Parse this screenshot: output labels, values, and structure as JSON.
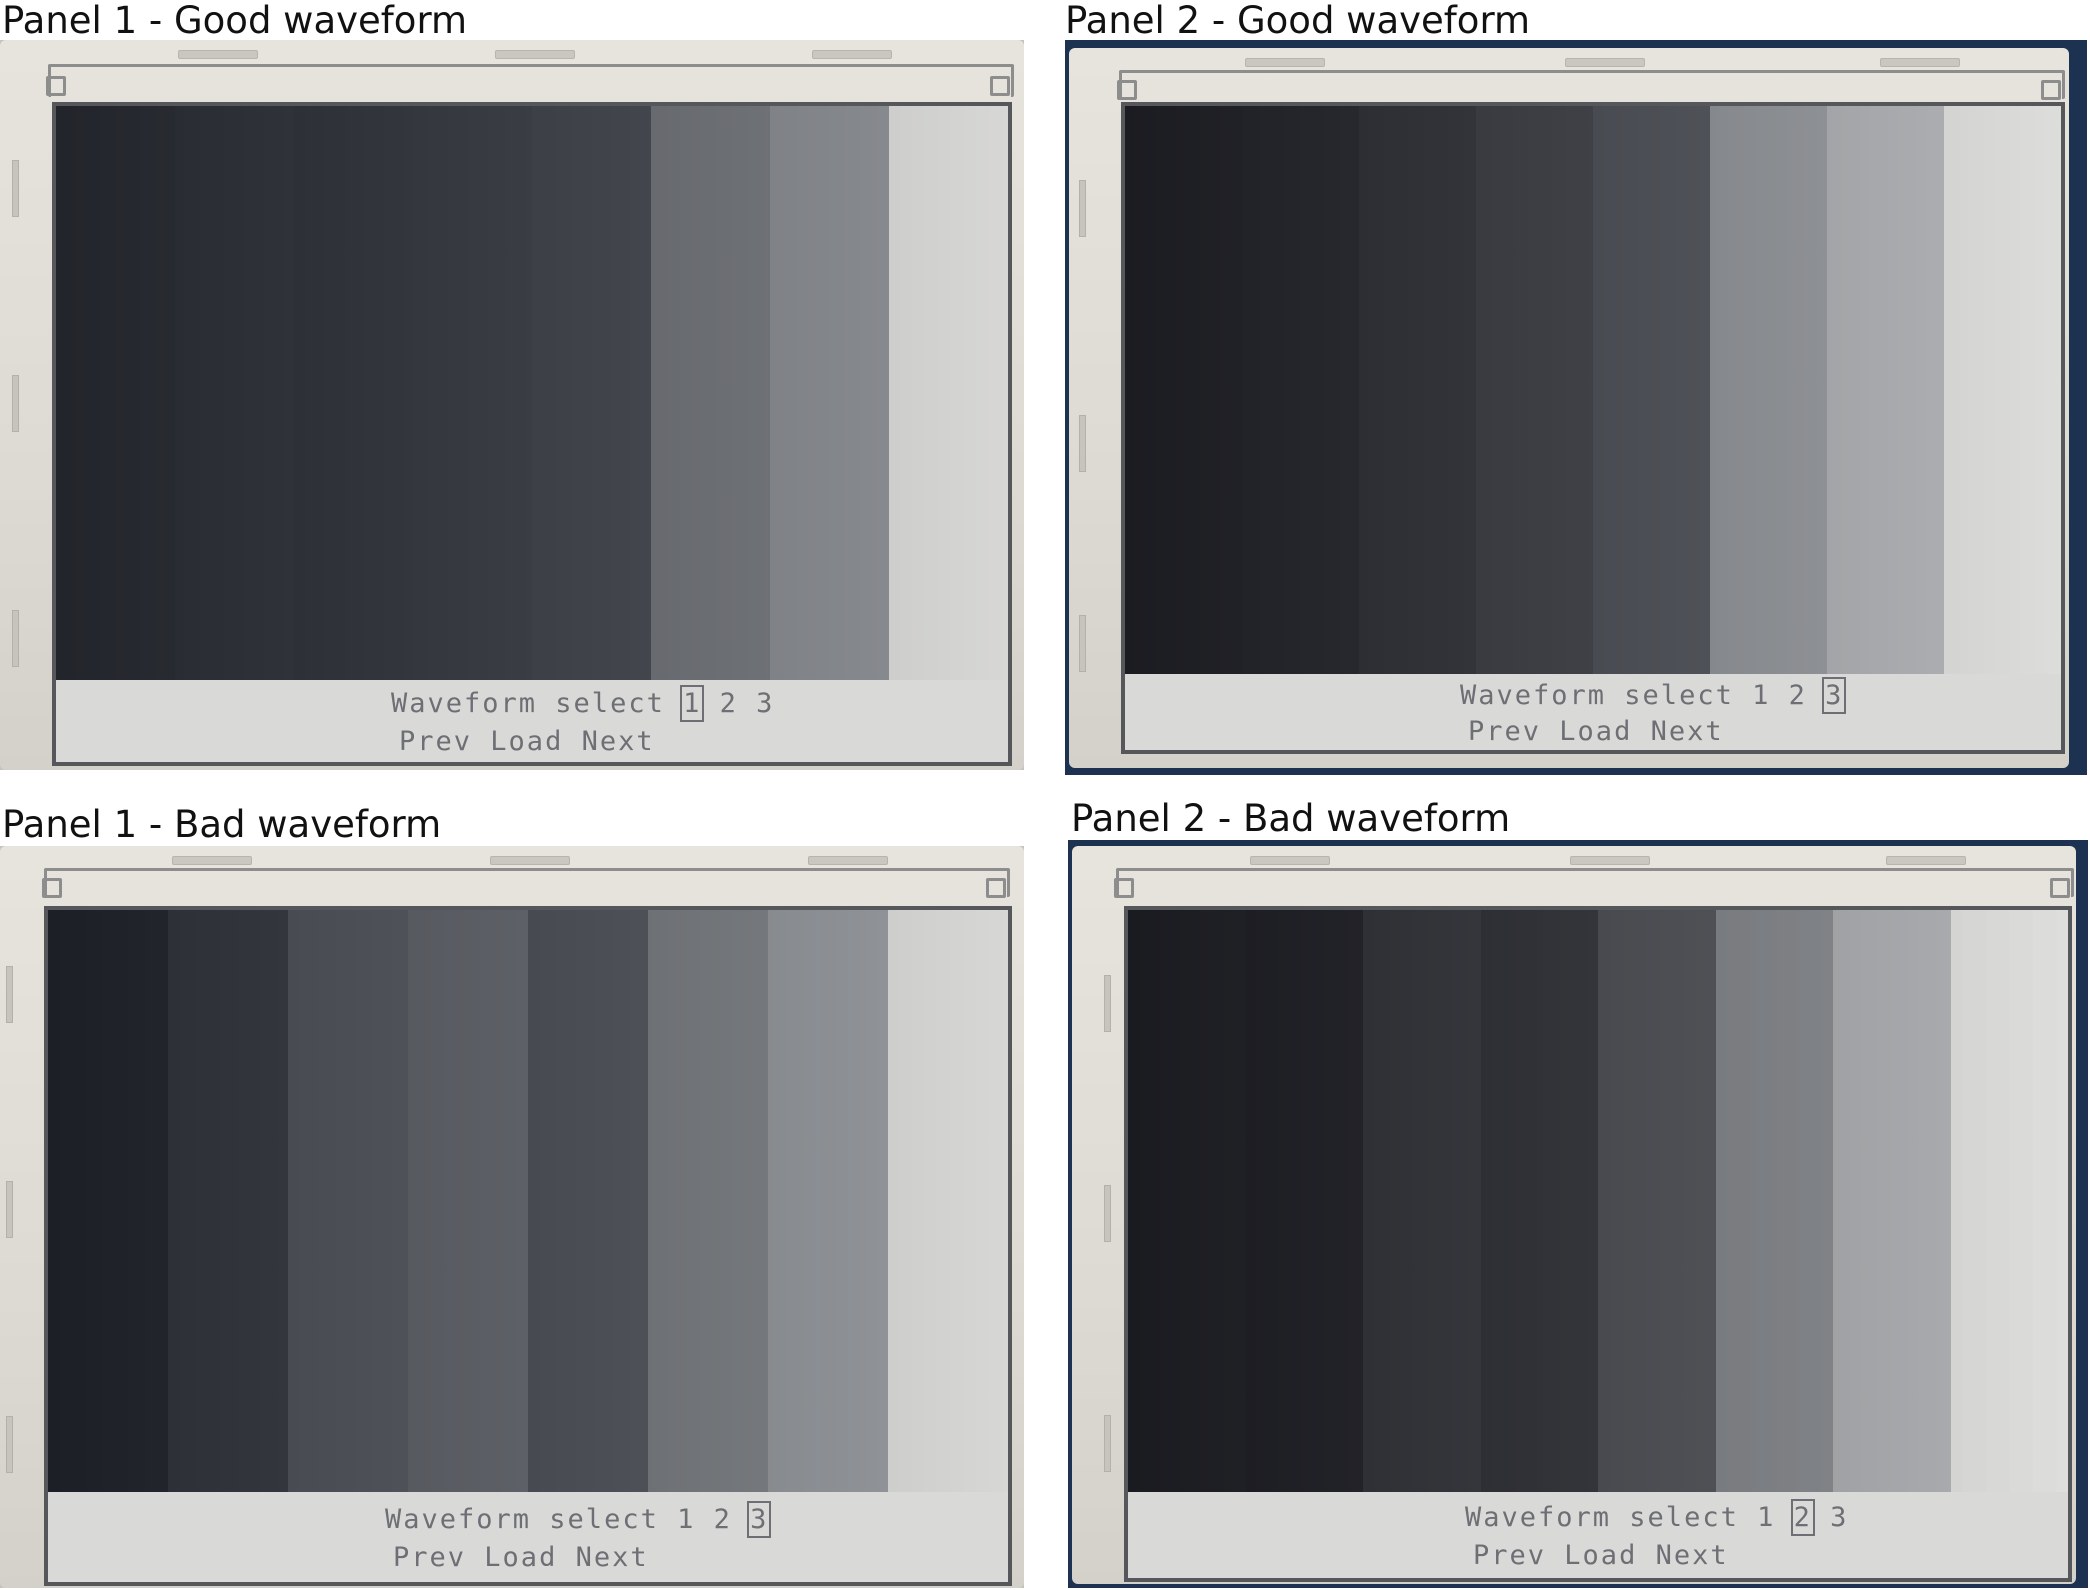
{
  "panels": [
    {
      "caption": "Panel 1 - Good waveform",
      "bars": [
        "#24262d",
        "#2b2e35",
        "#2f3239",
        "#363940",
        "#3f4249",
        "#6b6e73",
        "#84878c",
        "#d6d7d5"
      ],
      "waveform_label": "Waveform select",
      "options": [
        "1",
        "2",
        "3"
      ],
      "selected_option": "1",
      "nav": [
        "Prev",
        "Load",
        "Next"
      ]
    },
    {
      "caption": "Panel 2 - Good waveform",
      "bars": [
        "#1c1d22",
        "#22242a",
        "#2e3036",
        "#3b3d43",
        "#4b4e54",
        "#8b8e92",
        "#a9abae",
        "#dcdcda"
      ],
      "waveform_label": "Waveform select",
      "options": [
        "1",
        "2",
        "3"
      ],
      "selected_option": "3",
      "nav": [
        "Prev",
        "Load",
        "Next"
      ]
    },
    {
      "caption": "Panel 1 - Bad waveform",
      "bars": [
        "#1e2028",
        "#2f3239",
        "#4b4e55",
        "#5a5d63",
        "#4a4d54",
        "#727579",
        "#8d9094",
        "#d6d7d5"
      ],
      "waveform_label": "Waveform select",
      "options": [
        "1",
        "2",
        "3"
      ],
      "selected_option": "3",
      "nav": [
        "Prev",
        "Load",
        "Next"
      ]
    },
    {
      "caption": "Panel 2 - Bad waveform",
      "bars": [
        "#1b1c21",
        "#1e1f24",
        "#303237",
        "#2f3136",
        "#4b4d52",
        "#7d8084",
        "#a6a8ab",
        "#dddddb"
      ],
      "waveform_label": "Waveform select",
      "options": [
        "1",
        "2",
        "3"
      ],
      "selected_option": "2",
      "nav": [
        "Prev",
        "Load",
        "Next"
      ]
    }
  ]
}
